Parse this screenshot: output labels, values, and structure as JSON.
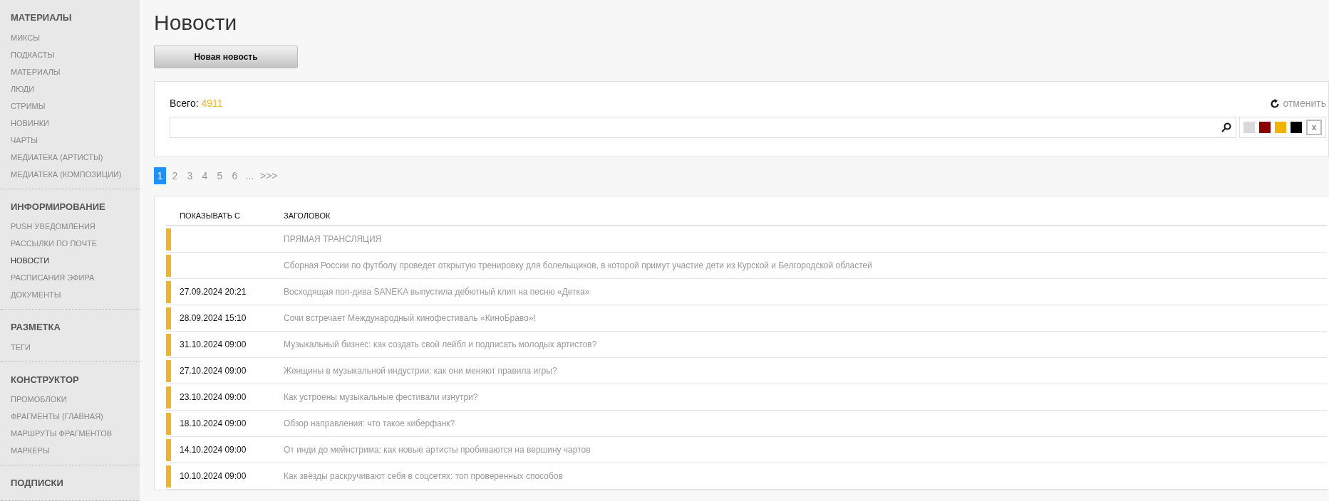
{
  "sidebar": {
    "sections": [
      {
        "title": "МАТЕРИАЛЫ",
        "items": [
          {
            "label": "МИКСЫ",
            "selected": false
          },
          {
            "label": "ПОДКАСТЫ",
            "selected": false
          },
          {
            "label": "МАТЕРИАЛЫ",
            "selected": false
          },
          {
            "label": "ЛЮДИ",
            "selected": false
          },
          {
            "label": "СТРИМЫ",
            "selected": false
          },
          {
            "label": "НОВИНКИ",
            "selected": false
          },
          {
            "label": "ЧАРТЫ",
            "selected": false
          },
          {
            "label": "МЕДИАТЕКА (АРТИСТЫ)",
            "selected": false
          },
          {
            "label": "МЕДИАТЕКА (КОМПОЗИЦИИ)",
            "selected": false
          }
        ]
      },
      {
        "title": "ИНФОРМИРОВАНИЕ",
        "items": [
          {
            "label": "PUSH УВЕДОМЛЕНИЯ",
            "selected": false
          },
          {
            "label": "РАССЫЛКИ ПО ПОЧТЕ",
            "selected": false
          },
          {
            "label": "НОВОСТИ",
            "selected": true
          },
          {
            "label": "РАСПИСАНИЯ ЭФИРА",
            "selected": false
          },
          {
            "label": "ДОКУМЕНТЫ",
            "selected": false
          }
        ]
      },
      {
        "title": "РАЗМЕТКА",
        "items": [
          {
            "label": "ТЕГИ",
            "selected": false
          }
        ]
      },
      {
        "title": "КОНСТРУКТОР",
        "items": [
          {
            "label": "ПРОМОБЛОКИ",
            "selected": false
          },
          {
            "label": "ФРАГМЕНТЫ (ГЛАВНАЯ)",
            "selected": false
          },
          {
            "label": "МАРШРУТЫ ФРАГМЕНТОВ",
            "selected": false
          },
          {
            "label": "МАРКЕРЫ",
            "selected": false
          }
        ]
      },
      {
        "title": "ПОДПИСКИ"
      }
    ]
  },
  "page_title": "Новости",
  "new_button": "Новая новость",
  "filter": {
    "total_label": "Всего:",
    "total_count": "4911",
    "reset_label": "отменить",
    "colors": [
      {
        "color": "#d9d9d9"
      },
      {
        "color": "#8b0000"
      },
      {
        "color": "#f0b400"
      },
      {
        "color": "#000000"
      }
    ],
    "clear_label": "x"
  },
  "pagination": [
    {
      "label": "1",
      "selected": true
    },
    {
      "label": "2",
      "selected": false
    },
    {
      "label": "3",
      "selected": false
    },
    {
      "label": "4",
      "selected": false
    },
    {
      "label": "5",
      "selected": false
    },
    {
      "label": "6",
      "selected": false
    },
    {
      "label": "...",
      "selected": false
    },
    {
      "label": ">>>",
      "selected": false
    }
  ],
  "table": {
    "columns": [
      "ПОКАЗЫВАТЬ С",
      "ЗАГОЛОВОК"
    ],
    "rows": [
      {
        "color": "#f0b429",
        "date": "",
        "title": "ПРЯМАЯ ТРАНСЛЯЦИЯ"
      },
      {
        "color": "#f0b429",
        "date": "",
        "title": "Сборная России по футболу проведет открытую тренировку для болельщиков, в которой примут участие дети из Курской и Белгородской областей"
      },
      {
        "color": "#f0b429",
        "date": "27.09.2024 20:21",
        "title": "Восходящая поп-дива SANEKA выпустила дебютный клип на песню «Детка»"
      },
      {
        "color": "#f0b429",
        "date": "28.09.2024 15:10",
        "title": "Сочи встречает Международный кинофестиваль «КиноБраво»!"
      },
      {
        "color": "#f0b429",
        "date": "31.10.2024 09:00",
        "title": "Музыкальный бизнес: как создать свой лейбл и подписать молодых артистов?"
      },
      {
        "color": "#f0b429",
        "date": "27.10.2024 09:00",
        "title": "Женщины в музыкальной индустрии: как они меняют правила игры?"
      },
      {
        "color": "#f0b429",
        "date": "23.10.2024 09:00",
        "title": "Как устроены музыкальные фестивали изнутри?"
      },
      {
        "color": "#f0b429",
        "date": "18.10.2024 09:00",
        "title": "Обзор направления: что такое киберфанк?"
      },
      {
        "color": "#f0b429",
        "date": "14.10.2024 09:00",
        "title": "От инди до мейнстрима: как новые артисты пробиваются на вершину чартов"
      },
      {
        "color": "#f0b429",
        "date": "10.10.2024 09:00",
        "title": "Как звёзды раскручивают себя в соцсетях: топ проверенных способов"
      }
    ]
  }
}
